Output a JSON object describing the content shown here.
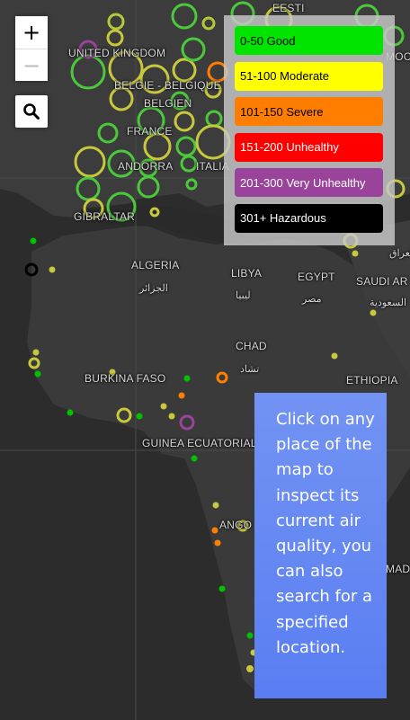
{
  "map": {
    "labels": {
      "estonia": "EESTI",
      "uk": "UNITED KINGDOM",
      "belgium_nl": "BELGIE - BELGIQUE",
      "belgium_en": "BELGIEN",
      "france": "FRANCE",
      "andorra": "ANDORRA",
      "italy": "ITALIA",
      "gibraltar": "GIBRALTAR",
      "algeria": "ALGERIA",
      "algeria_ar": "الجزائر",
      "libya": "LIBYA",
      "libya_ar": "ليبيا",
      "egypt": "EGYPT",
      "egypt_ar": "مصر",
      "saudi": "SAUDI AR",
      "saudi_ar": "السعودية",
      "iraq_ar": "العراق",
      "chad": "CHAD",
      "chad_ar": "تشاد",
      "burkina": "BURKINA FASO",
      "ethiopia": "ETHIOPIA",
      "guinea": "GUINEA ECUATORIAL",
      "angola": "ANGO",
      "mad": "MAD",
      "moc": "MOC"
    }
  },
  "controls": {
    "zoom_in": "+",
    "zoom_out": "−"
  },
  "legend": {
    "items": [
      {
        "label": "0-50 Good",
        "color": "#00e400",
        "text_color": "#000000"
      },
      {
        "label": "51-100 Moderate",
        "color": "#ffff00",
        "text_color": "#000000"
      },
      {
        "label": "101-150 Severe",
        "color": "#ff7e00",
        "text_color": "#000000"
      },
      {
        "label": "151-200 Unhealthy",
        "color": "#ff0000",
        "text_color": "#ffffff"
      },
      {
        "label": "201-300 Very Unhealthy",
        "color": "#99449a",
        "text_color": "#ffffff"
      },
      {
        "label": "301+ Hazardous",
        "color": "#000000",
        "text_color": "#ffffff"
      }
    ]
  },
  "info_panel": {
    "text": "Click on any place of the map to inspect its current air quality, you can also search for a specified location."
  }
}
